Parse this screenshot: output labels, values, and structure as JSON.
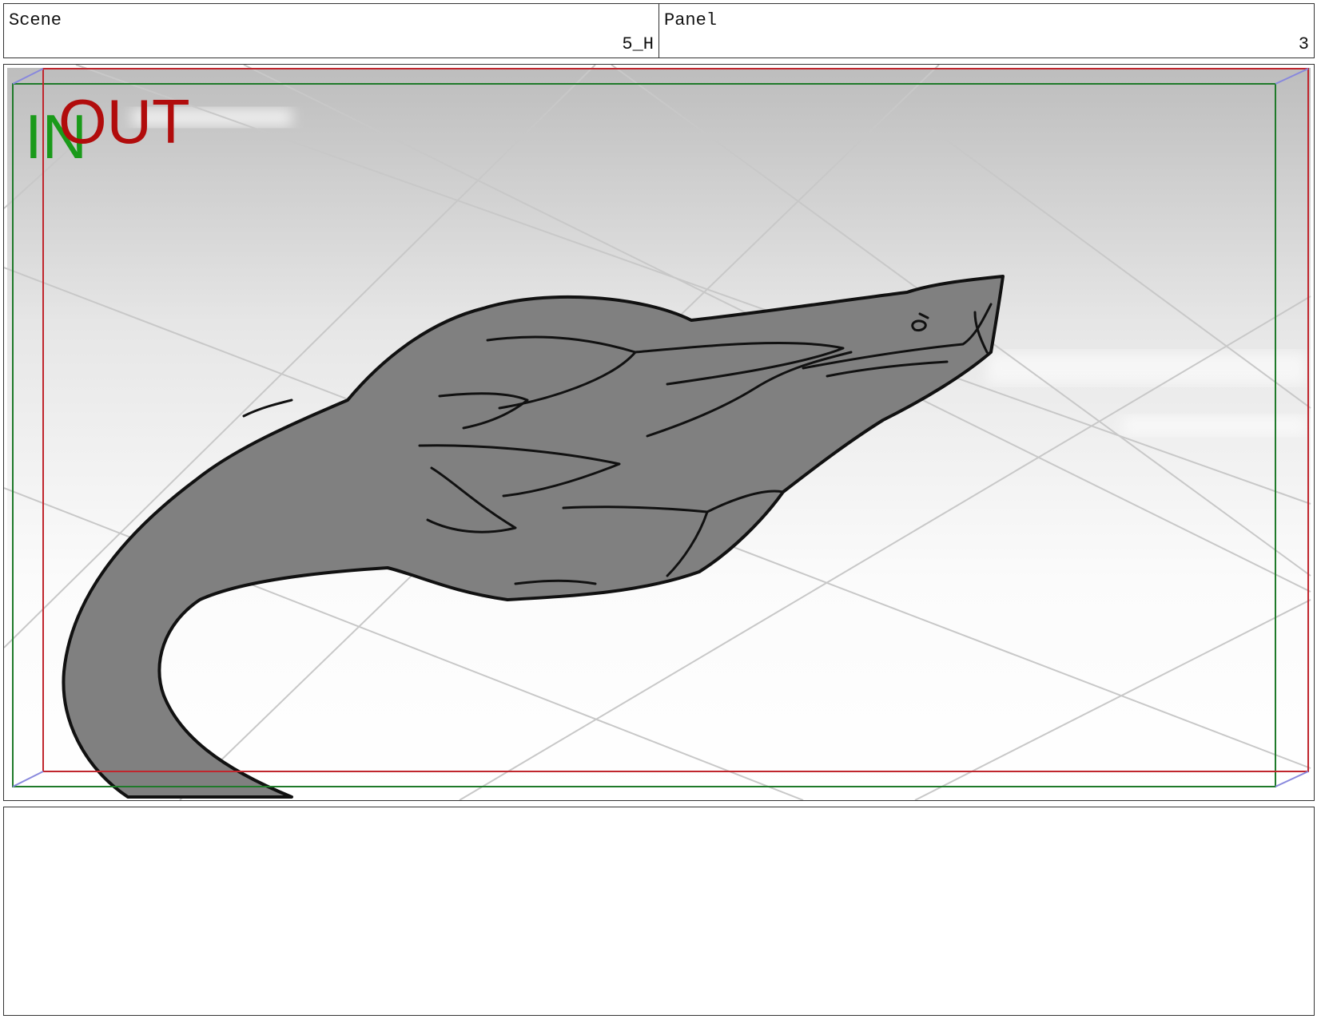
{
  "header": {
    "scene_label": "Scene",
    "scene_value": "5_H",
    "panel_label": "Panel",
    "panel_value": "3"
  },
  "frame": {
    "in_label": "IN",
    "out_label": "OUT",
    "in_color": "#1a9a1a",
    "out_color": "#b10c0c",
    "in_frame_color": "#1f7a2a",
    "out_frame_color": "#c0262d",
    "guide_color": "#8888dd"
  },
  "notes": {
    "text": ""
  }
}
